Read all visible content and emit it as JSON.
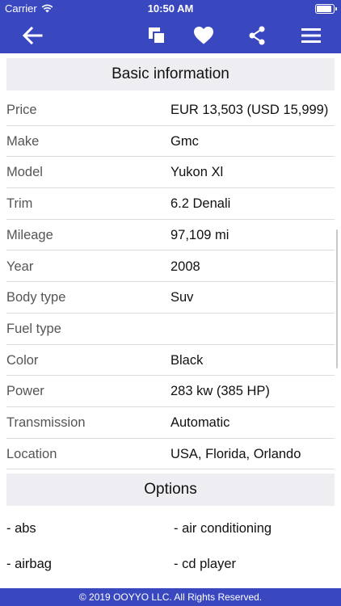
{
  "status_bar": {
    "carrier": "Carrier",
    "time": "10:50 AM"
  },
  "nav": {
    "icons": [
      "back-arrow-icon",
      "copy-icon",
      "heart-icon",
      "share-icon",
      "menu-icon"
    ]
  },
  "basic_info": {
    "title": "Basic information",
    "rows": [
      {
        "label": "Price",
        "value": "EUR 13,503 (USD 15,999)"
      },
      {
        "label": "Make",
        "value": "Gmc"
      },
      {
        "label": "Model",
        "value": "Yukon Xl"
      },
      {
        "label": "Trim",
        "value": "6.2 Denali"
      },
      {
        "label": "Mileage",
        "value": "97,109 mi"
      },
      {
        "label": "Year",
        "value": "2008"
      },
      {
        "label": "Body type",
        "value": "Suv"
      },
      {
        "label": "Fuel type",
        "value": ""
      },
      {
        "label": "Color",
        "value": "Black"
      },
      {
        "label": "Power",
        "value": "283 kw (385 HP)"
      },
      {
        "label": "Transmission",
        "value": "Automatic"
      },
      {
        "label": "Location",
        "value": "USA, Florida, Orlando"
      }
    ]
  },
  "options": {
    "title": "Options",
    "items": [
      "- abs",
      "- air conditioning",
      "- airbag",
      "- cd player"
    ]
  },
  "footer": {
    "text": "© 2019 OOYYO LLC. All Rights Reserved."
  },
  "colors": {
    "brand": "#3a48c0",
    "section_bg": "#eeeef2",
    "divider": "#dcdcdc"
  }
}
